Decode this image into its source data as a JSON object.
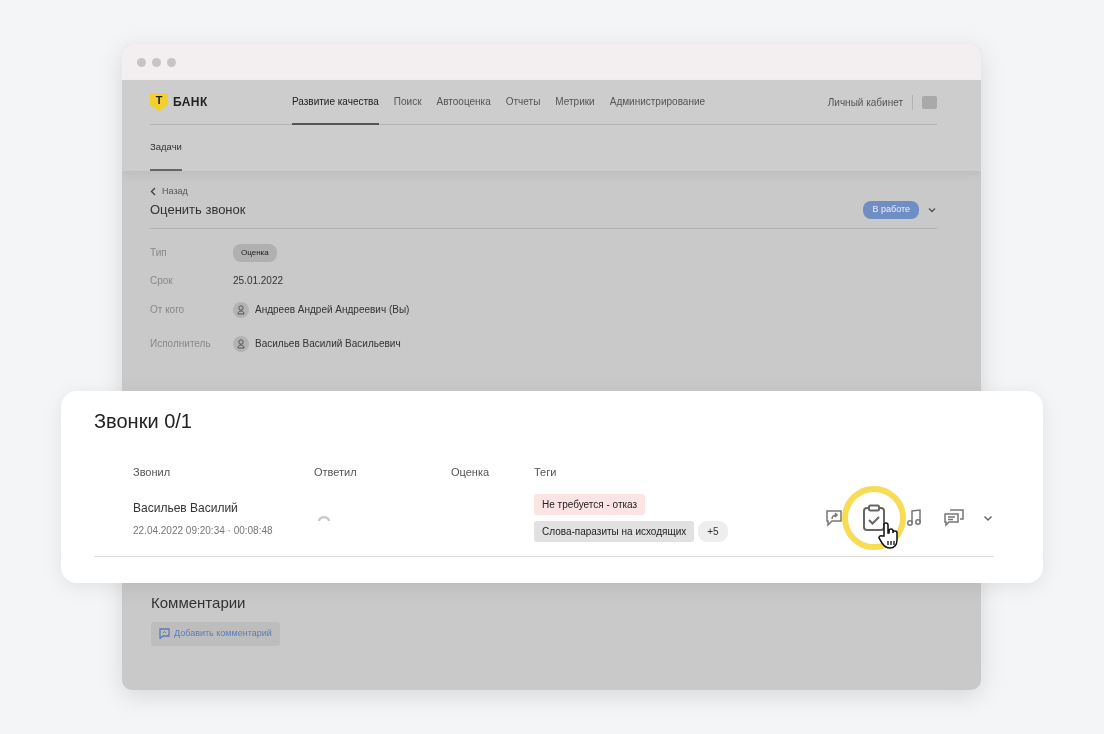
{
  "header": {
    "logo": {
      "mark": "Т",
      "text": "БАНК"
    },
    "nav": [
      {
        "label": "Развитие качества",
        "selected": true
      },
      {
        "label": "Поиск",
        "selected": false
      },
      {
        "label": "Автооценка",
        "selected": false
      },
      {
        "label": "Отчеты",
        "selected": false
      },
      {
        "label": "Метрики",
        "selected": false
      },
      {
        "label": "Администрирование",
        "selected": false
      }
    ],
    "account": "Личный кабинет"
  },
  "subnav": [
    {
      "label": "Задачи",
      "selected": true
    }
  ],
  "task": {
    "back": "Назад",
    "title": "Оценить звонок",
    "status": "В работе",
    "fields": [
      {
        "label": "Тип",
        "kind": "badge",
        "value": "Оценка"
      },
      {
        "label": "Срок",
        "kind": "text",
        "value": "25.01.2022"
      },
      {
        "label": "От кого",
        "kind": "person",
        "value": "Андреев Андрей Андреевич (Вы)"
      },
      {
        "label": "Исполнитель",
        "kind": "person",
        "value": "Васильев Василий Васильевич"
      }
    ]
  },
  "calls": {
    "title": "Звонки 0/1",
    "columns": [
      "Звонил",
      "Ответил",
      "Оценка",
      "Теги"
    ],
    "rows": [
      {
        "caller": "Васильев Василий",
        "meta": "22.04.2022 09:20:34 · 00:08:48",
        "tags": [
          {
            "label": "Не требуется - отказ",
            "color": "#fbe4e3"
          },
          {
            "label": "Слова-паразиты на исходящих",
            "color": "#e1e1e1"
          }
        ],
        "more": "+5",
        "actions": [
          {
            "kind": "share",
            "highlighted": false
          },
          {
            "kind": "clipboard",
            "highlighted": true
          },
          {
            "kind": "music",
            "highlighted": false
          },
          {
            "kind": "chat",
            "highlighted": false
          }
        ]
      }
    ]
  },
  "comments": {
    "title": "Комментарии",
    "add_button": "Добавить комментарий"
  }
}
